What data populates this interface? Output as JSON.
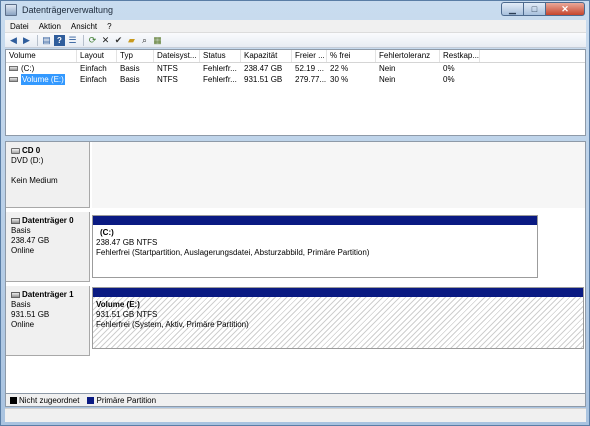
{
  "window": {
    "title": "Datenträgerverwaltung"
  },
  "menu": [
    "Datei",
    "Aktion",
    "Ansicht",
    "?"
  ],
  "toolbar": {
    "icons": [
      "back-icon",
      "forward-icon",
      "properties-icon",
      "help-icon",
      "list-view-icon",
      "refresh-icon",
      "delete-icon",
      "checkmark-icon",
      "open-icon",
      "search-icon",
      "settings-icon"
    ]
  },
  "volume_list": {
    "columns": [
      "Volume",
      "Layout",
      "Typ",
      "Dateisyst...",
      "Status",
      "Kapazität",
      "Freier ...",
      "% frei",
      "Fehlertoleranz",
      "Restkap..."
    ],
    "rows": [
      {
        "volume": "(C:)",
        "layout": "Einfach",
        "typ": "Basis",
        "fs": "NTFS",
        "status": "Fehlerfr...",
        "capacity": "238.47 GB",
        "free": "52.19 ...",
        "pct_free": "22 %",
        "fault": "Nein",
        "overhead": "0%",
        "selected": false
      },
      {
        "volume": "Volume (E:)",
        "layout": "Einfach",
        "typ": "Basis",
        "fs": "NTFS",
        "status": "Fehlerfr...",
        "capacity": "931.51 GB",
        "free": "279.77...",
        "pct_free": "30 %",
        "fault": "Nein",
        "overhead": "0%",
        "selected": true
      }
    ]
  },
  "disks": {
    "cd0": {
      "name": "CD 0",
      "type": "DVD (D:)",
      "status": "Kein Medium"
    },
    "disk0": {
      "name": "Datenträger 0",
      "type": "Basis",
      "size": "238.47 GB",
      "state": "Online",
      "partition": {
        "name": "(C:)",
        "size_fs": "238.47 GB NTFS",
        "status": "Fehlerfrei (Startpartition, Auslagerungsdatei, Absturzabbild, Primäre Partition)"
      }
    },
    "disk1": {
      "name": "Datenträger 1",
      "type": "Basis",
      "size": "931.51 GB",
      "state": "Online",
      "partition": {
        "name": "Volume  (E:)",
        "size_fs": "931.51 GB NTFS",
        "status": "Fehlerfrei (System, Aktiv, Primäre Partition)"
      }
    }
  },
  "legend": {
    "items": [
      {
        "label": "Nicht zugeordnet",
        "color": "#000000"
      },
      {
        "label": "Primäre Partition",
        "color": "#0a1a82"
      }
    ]
  }
}
